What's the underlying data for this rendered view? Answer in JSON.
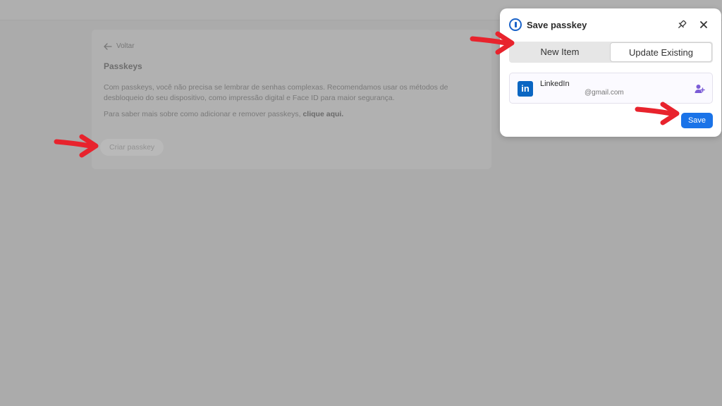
{
  "page": {
    "back_label": "Voltar",
    "title": "Passkeys",
    "description": "Com passkeys, você não precisa se lembrar de senhas complexas. Recomendamos usar os métodos de desbloqueio do seu dispositivo, como impressão digital e Face ID para maior segurança.",
    "more_info_prefix": "Para saber mais sobre como adicionar e remover passkeys,",
    "more_info_link": "clique aqui.",
    "create_button": "Criar passkey"
  },
  "popup": {
    "title": "Save passkey",
    "tabs": [
      {
        "label": "New Item",
        "selected": true
      },
      {
        "label": "Update Existing",
        "selected": false
      }
    ],
    "item": {
      "name": "LinkedIn",
      "logo_text": "in",
      "email": "@gmail.com"
    },
    "save_button": "Save",
    "icons": [
      "onepassword-logo-icon",
      "pin-icon",
      "close-icon",
      "linkedin-logo-icon",
      "person-add-icon"
    ]
  },
  "colors": {
    "accent": "#1a73e8",
    "linkedin": "#0a66c2",
    "annotation_arrow": "#e8232d",
    "overlay_background": "#ababab"
  }
}
